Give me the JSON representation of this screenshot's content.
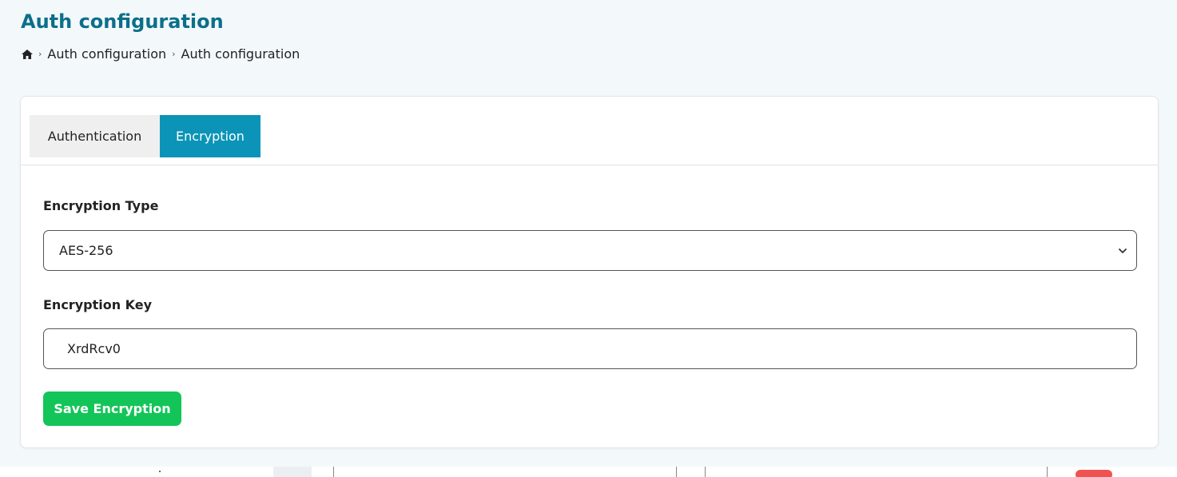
{
  "header": {
    "title": "Auth configuration",
    "breadcrumb": [
      "Auth configuration",
      "Auth configuration"
    ]
  },
  "tabs": [
    {
      "label": "Authentication",
      "active": false
    },
    {
      "label": "Encryption",
      "active": true
    }
  ],
  "form": {
    "encryption_type_label": "Encryption Type",
    "encryption_type_value": "AES-256",
    "encryption_key_label": "Encryption Key",
    "encryption_key_value": "XrdRcv0",
    "save_label": "Save Encryption"
  },
  "icons": {
    "home": "home-icon",
    "separator": "chevron-right-icon",
    "select": "chevron-down-icon"
  },
  "colors": {
    "title": "#0c6f8a",
    "active_tab": "#0b94b7",
    "save_button": "#13c559"
  }
}
